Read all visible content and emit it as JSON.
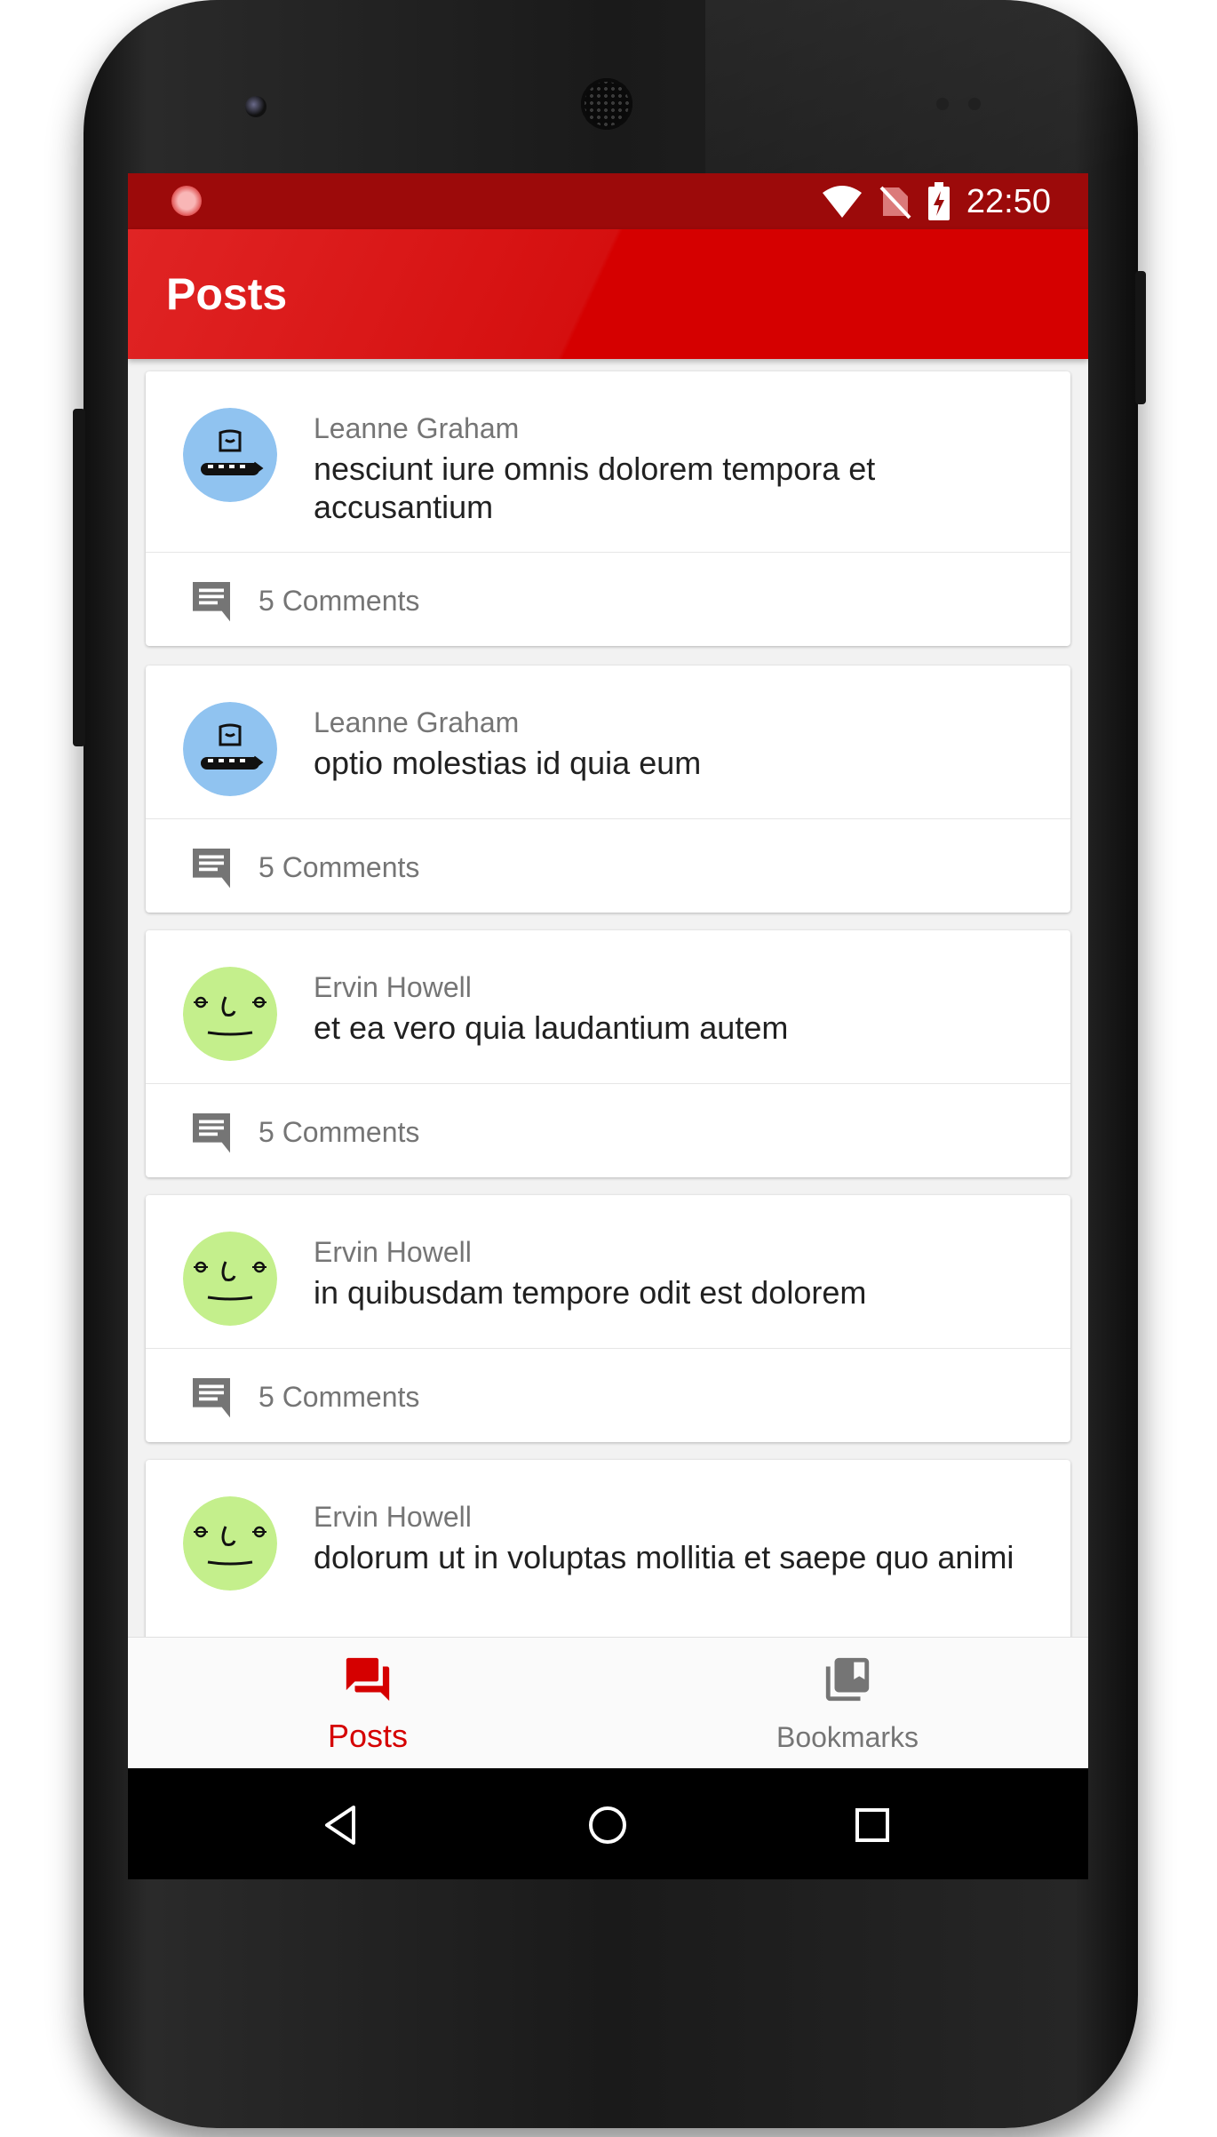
{
  "status_bar": {
    "time": "22:50",
    "icons": [
      "notification-dot-icon",
      "wifi-icon",
      "no-sim-icon",
      "battery-charging-icon"
    ]
  },
  "app_bar": {
    "title": "Posts"
  },
  "posts": [
    {
      "author": "Leanne Graham",
      "title": "nesciunt iure omnis dolorem tempora et accusantium",
      "comments": "5 Comments",
      "avatar": "blue-monster-avatar"
    },
    {
      "author": "Leanne Graham",
      "title": "optio molestias id quia eum",
      "comments": "5 Comments",
      "avatar": "blue-monster-avatar"
    },
    {
      "author": "Ervin Howell",
      "title": "et ea vero quia laudantium autem",
      "comments": "5 Comments",
      "avatar": "green-monster-avatar"
    },
    {
      "author": "Ervin Howell",
      "title": "in quibusdam tempore odit est dolorem",
      "comments": "5 Comments",
      "avatar": "green-monster-avatar"
    },
    {
      "author": "Ervin Howell",
      "title": "dolorum ut in voluptas mollitia et saepe quo animi",
      "comments": "",
      "avatar": "green-monster-avatar"
    }
  ],
  "bottom_nav": {
    "items": [
      {
        "label": "Posts",
        "icon": "forum-icon",
        "active": true
      },
      {
        "label": "Bookmarks",
        "icon": "bookmarks-icon",
        "active": false
      }
    ]
  },
  "system_nav": [
    "back-icon",
    "home-icon",
    "recents-icon"
  ],
  "colors": {
    "primary": "#d50000",
    "status_bar": "#9c0a0a",
    "avatar_blue": "#90c3f0",
    "avatar_green": "#c4ef8c"
  }
}
